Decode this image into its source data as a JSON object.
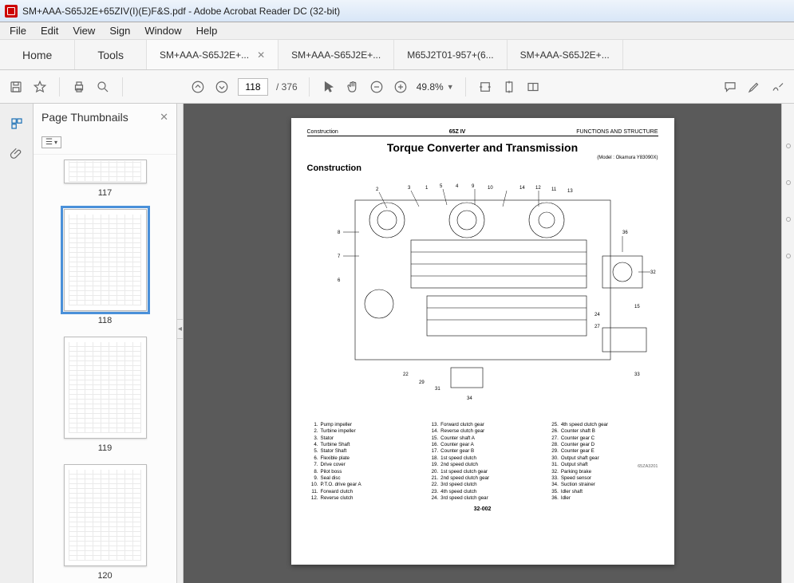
{
  "window": {
    "title": "SM+AAA-S65J2E+65ZIV(I)(E)F&S.pdf - Adobe Acrobat Reader DC (32-bit)"
  },
  "menu": [
    "File",
    "Edit",
    "View",
    "Sign",
    "Window",
    "Help"
  ],
  "maintabs": {
    "home": "Home",
    "tools": "Tools",
    "docs": [
      {
        "label": "SM+AAA-S65J2E+...",
        "active": true
      },
      {
        "label": "SM+AAA-S65J2E+...",
        "active": false
      },
      {
        "label": "M65J2T01-957+(6...",
        "active": false
      },
      {
        "label": "SM+AAA-S65J2E+...",
        "active": false
      }
    ]
  },
  "toolbar": {
    "page_current": "118",
    "page_total": "/ 376",
    "zoom": "49.8%"
  },
  "thumbnails": {
    "title": "Page Thumbnails",
    "items": [
      {
        "n": "117",
        "first": true
      },
      {
        "n": "118",
        "current": true
      },
      {
        "n": "119"
      },
      {
        "n": "120"
      }
    ]
  },
  "doc": {
    "header_left": "Construction",
    "header_mid": "65Z IV",
    "header_right": "FUNCTIONS AND STRUCTURE",
    "title": "Torque Converter and Transmission",
    "model": "(Model : Okamura Y83090X)",
    "section": "Construction",
    "fig_ref": "65ZA3201",
    "page_num": "32-002",
    "parts": [
      [
        {
          "n": "1.",
          "t": "Pump impeller"
        },
        {
          "n": "2.",
          "t": "Turbine impeller"
        },
        {
          "n": "3.",
          "t": "Stator"
        },
        {
          "n": "4.",
          "t": "Turbine Shaft"
        },
        {
          "n": "5.",
          "t": "Stator Shaft"
        },
        {
          "n": "6.",
          "t": "Flexible plate"
        },
        {
          "n": "7.",
          "t": "Drive cover"
        },
        {
          "n": "8.",
          "t": "Pilot boss"
        },
        {
          "n": "9.",
          "t": "Seal disc"
        },
        {
          "n": "10.",
          "t": "P.T.O. drive gear A"
        },
        {
          "n": "11.",
          "t": "Forward clutch"
        },
        {
          "n": "12.",
          "t": "Reverse clutch"
        }
      ],
      [
        {
          "n": "13.",
          "t": "Forward clutch gear"
        },
        {
          "n": "14.",
          "t": "Reverse clutch gear"
        },
        {
          "n": "15.",
          "t": "Counter shaft A"
        },
        {
          "n": "16.",
          "t": "Counter gear A"
        },
        {
          "n": "17.",
          "t": "Counter gear B"
        },
        {
          "n": "18.",
          "t": "1st speed clutch"
        },
        {
          "n": "19.",
          "t": "2nd speed clutch"
        },
        {
          "n": "20.",
          "t": "1st speed clutch gear"
        },
        {
          "n": "21.",
          "t": "2nd speed clutch gear"
        },
        {
          "n": "22.",
          "t": "3rd speed clutch"
        },
        {
          "n": "23.",
          "t": "4th speed clutch"
        },
        {
          "n": "24.",
          "t": "3rd speed clutch gear"
        }
      ],
      [
        {
          "n": "25.",
          "t": "4th speed clutch gear"
        },
        {
          "n": "26.",
          "t": "Counter shaft B"
        },
        {
          "n": "27.",
          "t": "Counter gear C"
        },
        {
          "n": "28.",
          "t": "Counter gear D"
        },
        {
          "n": "29.",
          "t": "Counter gear E"
        },
        {
          "n": "30.",
          "t": "Output shaft gear"
        },
        {
          "n": "31.",
          "t": "Output shaft"
        },
        {
          "n": "32.",
          "t": "Parking brake"
        },
        {
          "n": "33.",
          "t": "Speed sensor"
        },
        {
          "n": "34.",
          "t": "Suction strainer"
        },
        {
          "n": "35.",
          "t": "Idler shaft"
        },
        {
          "n": "36.",
          "t": "Idler"
        }
      ]
    ]
  }
}
